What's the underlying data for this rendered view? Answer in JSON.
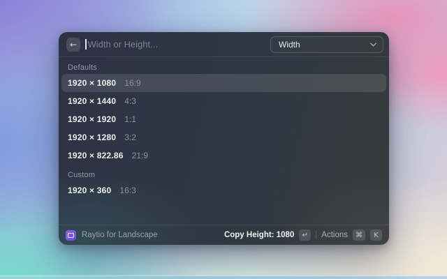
{
  "window": {
    "search": {
      "placeholder": "Width or Height..."
    },
    "dropdown": {
      "value": "Width"
    },
    "sections": [
      {
        "label": "Defaults",
        "items": [
          {
            "size": "1920 × 1080",
            "ratio": "16:9",
            "selected": true
          },
          {
            "size": "1920 × 1440",
            "ratio": "4:3"
          },
          {
            "size": "1920 × 1920",
            "ratio": "1:1"
          },
          {
            "size": "1920 × 1280",
            "ratio": "3:2"
          },
          {
            "size": "1920 × 822.86",
            "ratio": "21:9"
          }
        ]
      },
      {
        "label": "Custom",
        "items": [
          {
            "size": "1920 × 360",
            "ratio": "16:3"
          }
        ]
      }
    ],
    "footer": {
      "app_name": "Raytio for Landscape",
      "primary_action": "Copy Height: 1080",
      "actions_label": "Actions",
      "keys": {
        "enter": "↵",
        "command": "⌘",
        "k": "K"
      }
    }
  },
  "icons": {
    "back": "←",
    "chevron_down": "⌄"
  },
  "colors": {
    "accent_purple": "#7a58dd",
    "window_bg": "#2f3742",
    "selected_row": "rgba(255,255,255,0.12)",
    "bg_purple": "#8d79d8",
    "bg_blue": "#a9c4e5",
    "bg_pink": "#e794ba",
    "bg_teal": "#73ddca",
    "bg_cream": "#f2ebd6"
  }
}
